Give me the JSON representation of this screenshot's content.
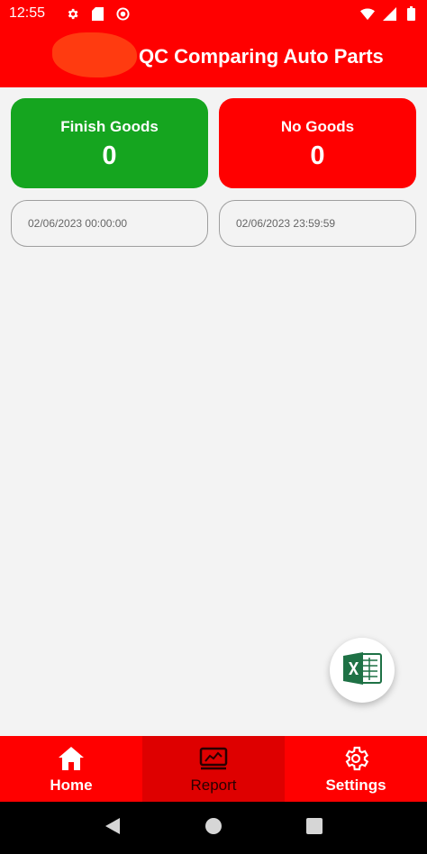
{
  "status_bar": {
    "time": "12:55",
    "left_icons": [
      "settings-icon",
      "sd-card-icon",
      "circle-record-icon"
    ],
    "right_icons": [
      "wifi-icon",
      "signal-icon",
      "battery-icon"
    ]
  },
  "app_bar": {
    "title": "QC Comparing Auto Parts"
  },
  "cards": {
    "finish_goods": {
      "label": "Finish Goods",
      "value": "0",
      "color": "#15a51f"
    },
    "no_goods": {
      "label": "No Goods",
      "value": "0",
      "color": "#ff0000"
    }
  },
  "date_range": {
    "from": "02/06/2023 00:00:00",
    "to": "02/06/2023 23:59:59"
  },
  "fab": {
    "icon": "excel-icon"
  },
  "bottom_nav": {
    "items": [
      {
        "label": "Home",
        "icon": "home-icon"
      },
      {
        "label": "Report",
        "icon": "report-chart-icon"
      },
      {
        "label": "Settings",
        "icon": "gear-icon"
      }
    ],
    "active": "Report"
  },
  "colors": {
    "primary": "#ff0000",
    "accent_green": "#15a51f",
    "background": "#f3f3f3"
  }
}
